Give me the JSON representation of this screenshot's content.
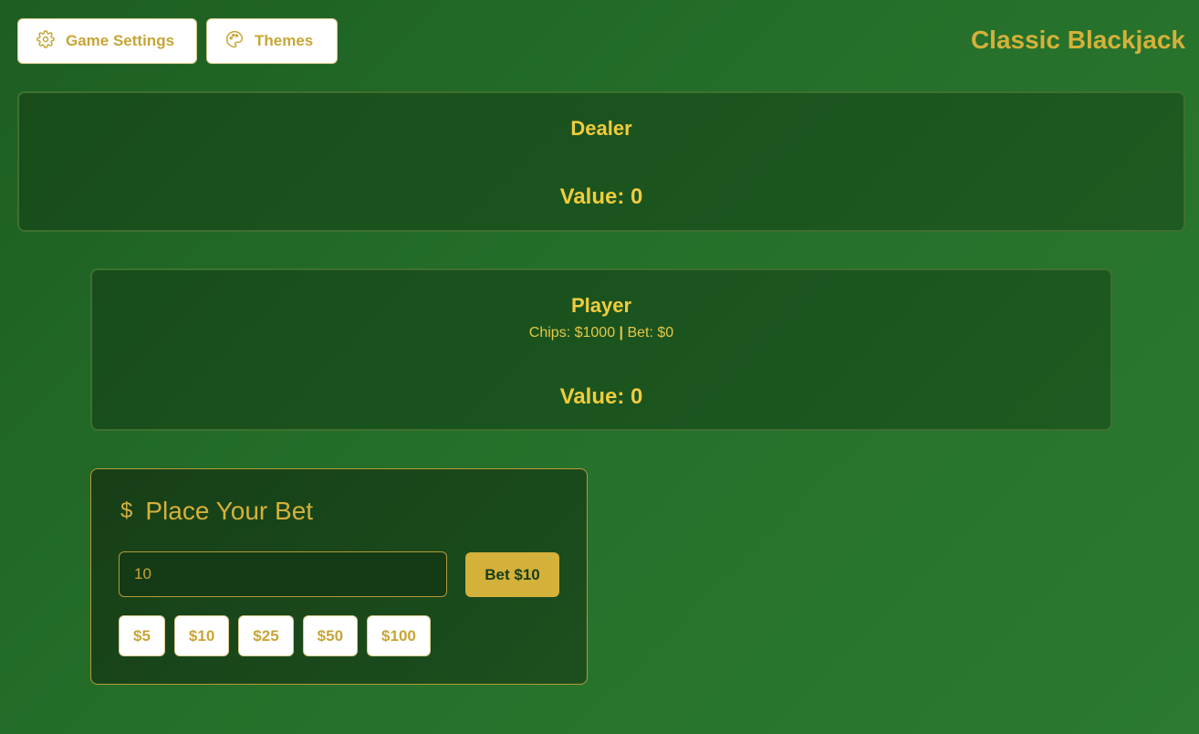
{
  "header": {
    "settings_label": "Game Settings",
    "themes_label": "Themes",
    "title": "Classic Blackjack"
  },
  "dealer": {
    "title": "Dealer",
    "value_text": "Value: 0"
  },
  "player": {
    "title": "Player",
    "chips_text": "Chips: $1000",
    "separator": "|",
    "bet_text": "Bet: $0",
    "value_text": "Value: 0"
  },
  "bet_panel": {
    "heading": "Place Your Bet",
    "icon": "dollar-icon",
    "input_value": "10",
    "submit_label": "Bet $10",
    "chips": [
      "$5",
      "$10",
      "$25",
      "$50",
      "$100"
    ]
  },
  "colors": {
    "felt": "#256f2a",
    "gold": "#d4b13a",
    "panel": "#184d1b"
  }
}
